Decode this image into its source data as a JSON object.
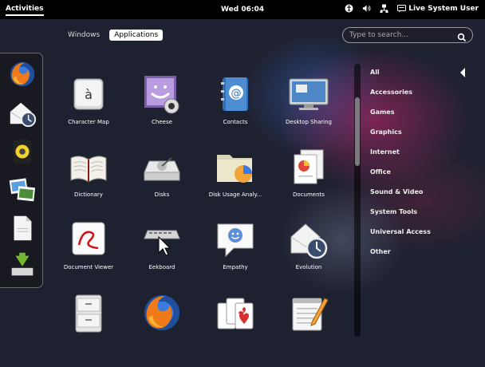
{
  "topbar": {
    "activities": "Activities",
    "clock": "Wed 06:04",
    "user": "Live System User"
  },
  "view_selector": {
    "windows": "Windows",
    "applications": "Applications"
  },
  "search": {
    "placeholder": "Type to search..."
  },
  "apps": [
    {
      "label": "Character Map",
      "icon": "character-map-icon"
    },
    {
      "label": "Cheese",
      "icon": "cheese-icon"
    },
    {
      "label": "Contacts",
      "icon": "contacts-icon"
    },
    {
      "label": "Desktop Sharing",
      "icon": "desktop-sharing-icon"
    },
    {
      "label": "Dictionary",
      "icon": "dictionary-icon"
    },
    {
      "label": "Disks",
      "icon": "disks-icon"
    },
    {
      "label": "Disk Usage Analy...",
      "icon": "disk-usage-icon"
    },
    {
      "label": "Documents",
      "icon": "documents-icon"
    },
    {
      "label": "Document Viewer",
      "icon": "document-viewer-icon"
    },
    {
      "label": "Eekboard",
      "icon": "eekboard-icon"
    },
    {
      "label": "Empathy",
      "icon": "empathy-icon"
    },
    {
      "label": "Evolution",
      "icon": "evolution-icon"
    }
  ],
  "categories": [
    "All",
    "Accessories",
    "Games",
    "Graphics",
    "Internet",
    "Office",
    "Sound & Video",
    "System Tools",
    "Universal Access",
    "Other"
  ],
  "dash": [
    "firefox-icon",
    "evolution-icon",
    "rhythmbox-icon",
    "shotwell-icon",
    "files-icon",
    "install-icon"
  ]
}
